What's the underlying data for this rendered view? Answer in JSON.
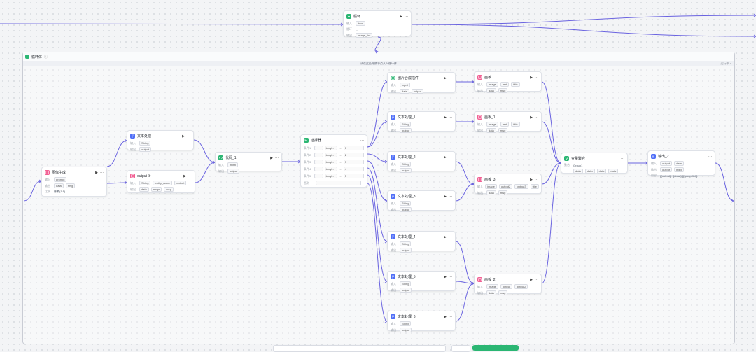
{
  "loop": {
    "title": "循环体",
    "subtitle": "请在此处拖拽节点从入循环体",
    "right_label": "运行中 ×"
  },
  "icons": {
    "start": "flow-icon",
    "doc": "document-icon",
    "image": "image-icon",
    "code": "code-icon",
    "cond": "branch-icon",
    "var": "variable-icon",
    "run": "play-icon",
    "more": "more-icon"
  },
  "colors": {
    "green": "#2bb673",
    "blue": "#4f6ef7",
    "pink": "#f25f93",
    "edge": "#6a63e0"
  },
  "nodes": {
    "loop_top": {
      "title": "循环",
      "r1": "Item",
      "r2": "...",
      "r3": "Image_list"
    },
    "gen": {
      "title": "图像生成",
      "r1": "prompt",
      "r2a": "data",
      "r2b": "msg",
      "r3": "像素(1:1)",
      "r4": ""
    },
    "text_proc": {
      "title": "文本处理",
      "r1": "String",
      "r2": "output"
    },
    "output_a": {
      "title": "output ①",
      "r1": "",
      "r2a": "String",
      "r2b": "entity_name",
      "r2c": "output",
      "r3a": "data",
      "r3b": "msgs",
      "r3c": "msg"
    },
    "code1": {
      "title": "代码_1",
      "r1": "input",
      "r2": "output"
    },
    "cond": {
      "title": "选择器",
      "rows": [
        {
          "label": "条件1",
          "field": "length",
          "op": "=",
          "val": "1"
        },
        {
          "label": "条件2",
          "field": "length",
          "op": "=",
          "val": "2"
        },
        {
          "label": "条件3",
          "field": "length",
          "op": "=",
          "val": "3"
        },
        {
          "label": "条件4",
          "field": "length",
          "op": "=",
          "val": "4"
        },
        {
          "label": "条件5",
          "field": "length",
          "op": "=",
          "val": "5"
        }
      ],
      "else": "否则"
    },
    "img_embed": {
      "title": "图片合成插件",
      "r1": "input",
      "r2a": "data",
      "r2b": "output"
    },
    "txt1": {
      "title": "文本处理_1",
      "r1": "String",
      "r2": "output"
    },
    "txt2": {
      "title": "文本处理_2",
      "r1": "String",
      "r2": "output"
    },
    "txt3": {
      "title": "文本处理_3",
      "r1": "String",
      "r2": "output"
    },
    "txt4": {
      "title": "文本处理_4",
      "r1": "String",
      "r2": "output"
    },
    "txt5": {
      "title": "文本处理_5",
      "r1": "String",
      "r2": "output"
    },
    "txt6": {
      "title": "文本处理_6",
      "r1": "String",
      "r2": "output"
    },
    "img0": {
      "title": "画板",
      "r1": [
        "image",
        "text",
        "title"
      ],
      "r2": [
        "data",
        "msg"
      ]
    },
    "img1": {
      "title": "画板_1",
      "r1": [
        "image",
        "text",
        "title"
      ],
      "r2": [
        "data",
        "msg"
      ]
    },
    "img3": {
      "title": "画板_3",
      "r1": [
        "image",
        "output2",
        "output3",
        "title"
      ],
      "r2": [
        "data",
        "msg"
      ]
    },
    "img2": {
      "title": "画板_2",
      "r1": [
        "image",
        "output",
        "output2"
      ],
      "r2": [
        "data",
        "msg"
      ]
    },
    "var": {
      "title": "变量聚合",
      "r1": "Group1",
      "r2": [
        "data",
        "data",
        "data",
        "data"
      ]
    },
    "out2": {
      "title": "输出_2",
      "r1": [
        "output",
        "data"
      ],
      "r2": [
        "output",
        "msg"
      ],
      "r3": "{{output}} {{data}} {{group list}}"
    }
  }
}
